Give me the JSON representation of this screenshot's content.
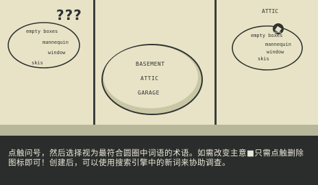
{
  "panel1": {
    "question_marks": "???",
    "words": [
      "empty boxes",
      "mannequin",
      "window",
      "skis"
    ]
  },
  "panel2": {
    "options": [
      "BASEMENT",
      "ATTIC",
      "GARAGE"
    ]
  },
  "panel3": {
    "label": "ATTIC",
    "words": [
      "empty boxes",
      "mannequin",
      "window",
      "skis"
    ]
  },
  "dialog": {
    "text": "点触问号，然后选择视为最符合圆圈中词语的术语。如需改变主意■只需点触删除图标即可！创建后，可以使用搜索引擎中的新词来协助调查。"
  },
  "colors": {
    "paper": "#e8e3c6",
    "ink": "#2e3230",
    "dialog_bg": "#2b2d2c",
    "dialog_text": "#e9e7d8"
  }
}
